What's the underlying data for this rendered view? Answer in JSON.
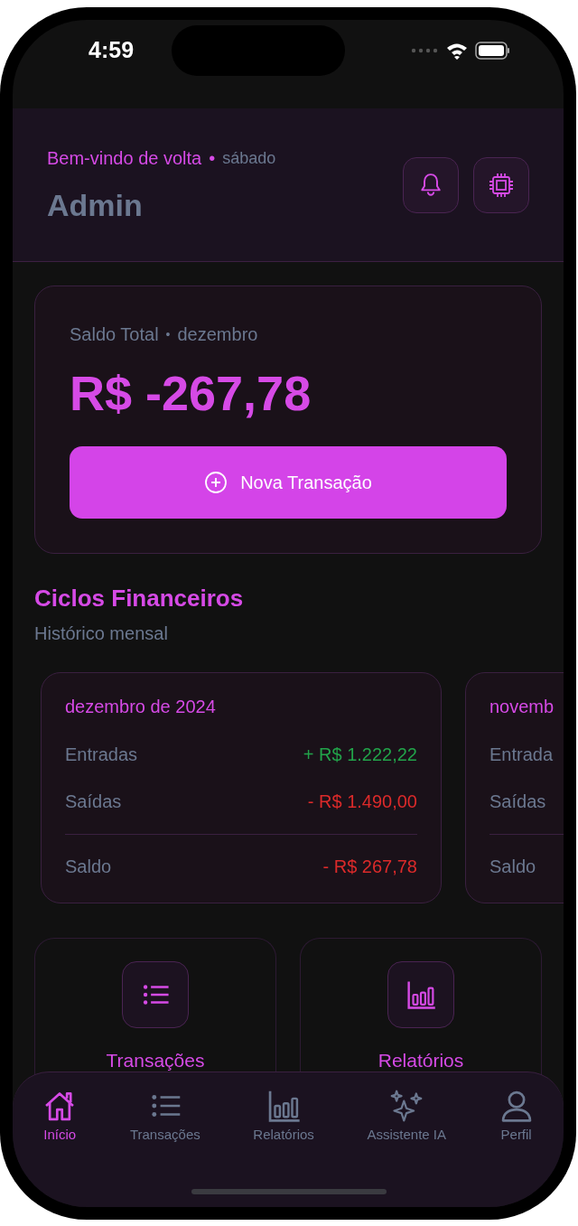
{
  "status_bar": {
    "time": "4:59"
  },
  "header": {
    "greeting": "Bem-vindo de volta",
    "separator": "•",
    "day": "sábado",
    "user": "Admin"
  },
  "balance": {
    "label": "Saldo Total",
    "separator": "•",
    "month": "dezembro",
    "amount": "R$ -267,78",
    "button": "Nova Transação"
  },
  "cycles": {
    "title": "Ciclos Financeiros",
    "subtitle": "Histórico mensal",
    "cards": [
      {
        "title": "dezembro de 2024",
        "rows": [
          {
            "label": "Entradas",
            "value": "+ R$ 1.222,22",
            "kind": "income"
          },
          {
            "label": "Saídas",
            "value": "- R$ 1.490,00",
            "kind": "expense"
          },
          {
            "label": "Saldo",
            "value": "- R$ 267,78",
            "kind": "total"
          }
        ]
      },
      {
        "title": "novemb",
        "rows": [
          {
            "label": "Entrada",
            "kind": "income"
          },
          {
            "label": "Saídas",
            "kind": "expense"
          },
          {
            "label": "Saldo",
            "kind": "total"
          }
        ]
      }
    ]
  },
  "shortcuts": [
    {
      "label": "Transações",
      "kind": "list"
    },
    {
      "label": "Relatórios",
      "kind": "chart"
    }
  ],
  "nav": [
    {
      "label": "Início",
      "kind": "home",
      "selected": true
    },
    {
      "label": "Transações",
      "kind": "list",
      "selected": false
    },
    {
      "label": "Relatórios",
      "kind": "chart",
      "selected": false
    },
    {
      "label": "Assistente IA",
      "kind": "sparkle",
      "selected": false
    },
    {
      "label": "Perfil",
      "kind": "person",
      "selected": false
    }
  ]
}
